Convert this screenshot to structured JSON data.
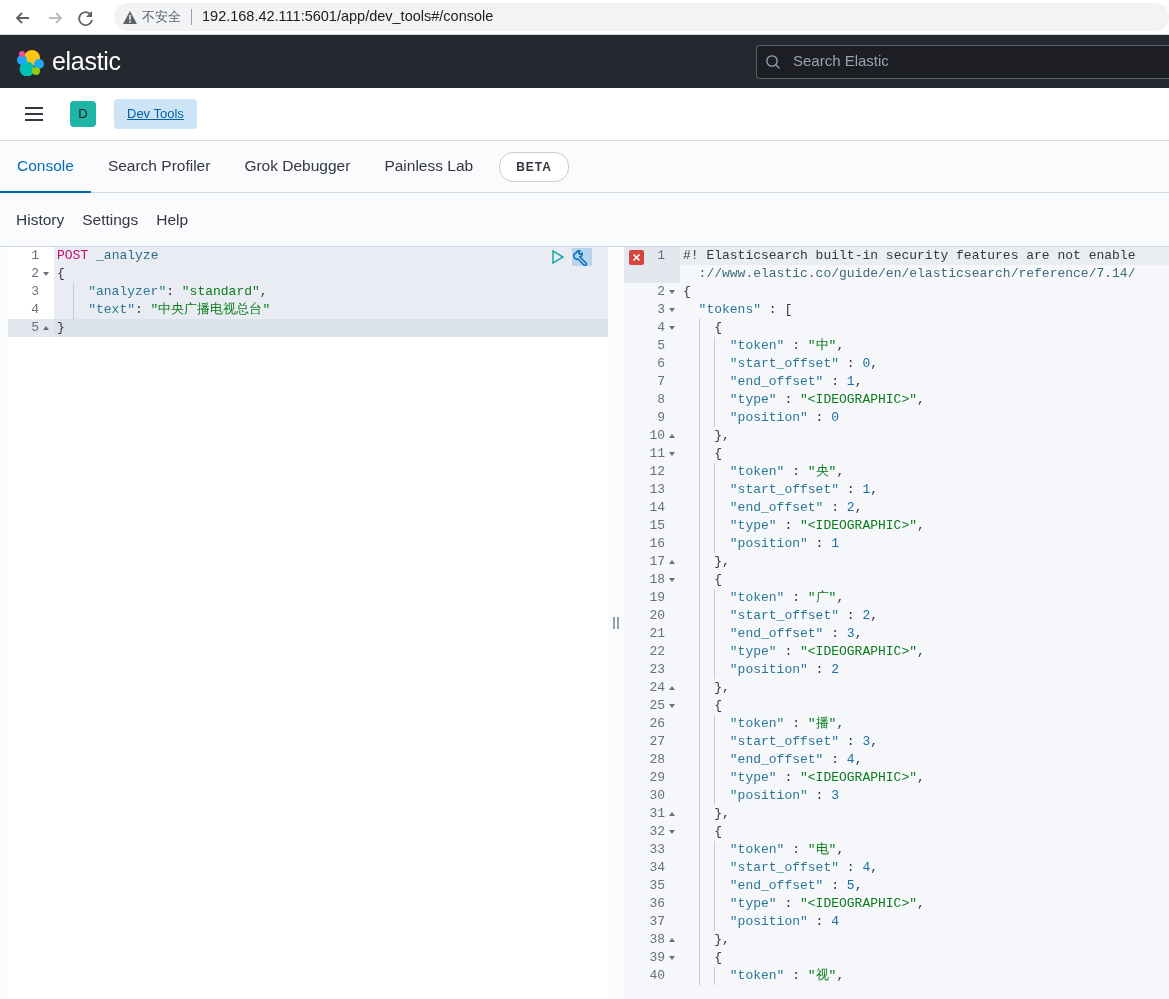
{
  "browser": {
    "nav_buttons": [
      {
        "kind": "back",
        "disabled": false
      },
      {
        "kind": "forward",
        "disabled": true
      },
      {
        "kind": "reload",
        "disabled": false
      }
    ],
    "security_label": "不安全",
    "url": "192.168.42.111:5601/app/dev_tools#/console"
  },
  "header": {
    "logo_text": "elastic",
    "search": {
      "placeholder": "Search Elastic"
    }
  },
  "breadcrumb_bar": {
    "avatar": "D",
    "crumb": "Dev Tools"
  },
  "tabs": [
    {
      "label": "Console",
      "selected": true
    },
    {
      "label": "Search Profiler",
      "selected": false
    },
    {
      "label": "Grok Debugger",
      "selected": false
    },
    {
      "label": "Painless Lab",
      "selected": false,
      "badge": "BETA"
    }
  ],
  "toolbar_links": [
    "History",
    "Settings",
    "Help"
  ],
  "request_editor": {
    "lines": [
      {
        "number": "1",
        "kind": "plain",
        "text": "POST _analyze",
        "active": false
      },
      {
        "number": "2",
        "kind": "fold_start",
        "text": "{",
        "active": false
      },
      {
        "number": "3",
        "kind": "plain",
        "text": "    \"analyzer\": \"standard\",",
        "active": false
      },
      {
        "number": "4",
        "kind": "plain",
        "text": "    \"text\": \"中央广播电视总台\"",
        "active": false
      },
      {
        "number": "5",
        "kind": "fold_end",
        "text": "}",
        "active": true
      }
    ]
  },
  "response_editor": {
    "lines": [
      {
        "number": "1",
        "kind": "plain",
        "error": true,
        "active": true,
        "text": "#! Elasticsearch built-in security features are not enable",
        "continuation": "://www.elastic.co/guide/en/elasticsearch/reference/7.14/"
      },
      {
        "number": "2",
        "kind": "fold_start",
        "text": "{"
      },
      {
        "number": "3",
        "kind": "fold_start",
        "text": "  \"tokens\" : ["
      },
      {
        "number": "4",
        "kind": "fold_start",
        "text": "    {"
      },
      {
        "number": "5",
        "kind": "plain",
        "text": "      \"token\" : \"中\","
      },
      {
        "number": "6",
        "kind": "plain",
        "text": "      \"start_offset\" : 0,"
      },
      {
        "number": "7",
        "kind": "plain",
        "text": "      \"end_offset\" : 1,"
      },
      {
        "number": "8",
        "kind": "plain",
        "text": "      \"type\" : \"<IDEOGRAPHIC>\","
      },
      {
        "number": "9",
        "kind": "plain",
        "text": "      \"position\" : 0"
      },
      {
        "number": "10",
        "kind": "fold_end",
        "text": "    },"
      },
      {
        "number": "11",
        "kind": "fold_start",
        "text": "    {"
      },
      {
        "number": "12",
        "kind": "plain",
        "text": "      \"token\" : \"央\","
      },
      {
        "number": "13",
        "kind": "plain",
        "text": "      \"start_offset\" : 1,"
      },
      {
        "number": "14",
        "kind": "plain",
        "text": "      \"end_offset\" : 2,"
      },
      {
        "number": "15",
        "kind": "plain",
        "text": "      \"type\" : \"<IDEOGRAPHIC>\","
      },
      {
        "number": "16",
        "kind": "plain",
        "text": "      \"position\" : 1"
      },
      {
        "number": "17",
        "kind": "fold_end",
        "text": "    },"
      },
      {
        "number": "18",
        "kind": "fold_start",
        "text": "    {"
      },
      {
        "number": "19",
        "kind": "plain",
        "text": "      \"token\" : \"广\","
      },
      {
        "number": "20",
        "kind": "plain",
        "text": "      \"start_offset\" : 2,"
      },
      {
        "number": "21",
        "kind": "plain",
        "text": "      \"end_offset\" : 3,"
      },
      {
        "number": "22",
        "kind": "plain",
        "text": "      \"type\" : \"<IDEOGRAPHIC>\","
      },
      {
        "number": "23",
        "kind": "plain",
        "text": "      \"position\" : 2"
      },
      {
        "number": "24",
        "kind": "fold_end",
        "text": "    },"
      },
      {
        "number": "25",
        "kind": "fold_start",
        "text": "    {"
      },
      {
        "number": "26",
        "kind": "plain",
        "text": "      \"token\" : \"播\","
      },
      {
        "number": "27",
        "kind": "plain",
        "text": "      \"start_offset\" : 3,"
      },
      {
        "number": "28",
        "kind": "plain",
        "text": "      \"end_offset\" : 4,"
      },
      {
        "number": "29",
        "kind": "plain",
        "text": "      \"type\" : \"<IDEOGRAPHIC>\","
      },
      {
        "number": "30",
        "kind": "plain",
        "text": "      \"position\" : 3"
      },
      {
        "number": "31",
        "kind": "fold_end",
        "text": "    },"
      },
      {
        "number": "32",
        "kind": "fold_start",
        "text": "    {"
      },
      {
        "number": "33",
        "kind": "plain",
        "text": "      \"token\" : \"电\","
      },
      {
        "number": "34",
        "kind": "plain",
        "text": "      \"start_offset\" : 4,"
      },
      {
        "number": "35",
        "kind": "plain",
        "text": "      \"end_offset\" : 5,"
      },
      {
        "number": "36",
        "kind": "plain",
        "text": "      \"type\" : \"<IDEOGRAPHIC>\","
      },
      {
        "number": "37",
        "kind": "plain",
        "text": "      \"position\" : 4"
      },
      {
        "number": "38",
        "kind": "fold_end",
        "text": "    },"
      },
      {
        "number": "39",
        "kind": "fold_start",
        "text": "    {"
      },
      {
        "number": "40",
        "kind": "plain",
        "text": "      \"token\" : \"视\","
      }
    ]
  }
}
